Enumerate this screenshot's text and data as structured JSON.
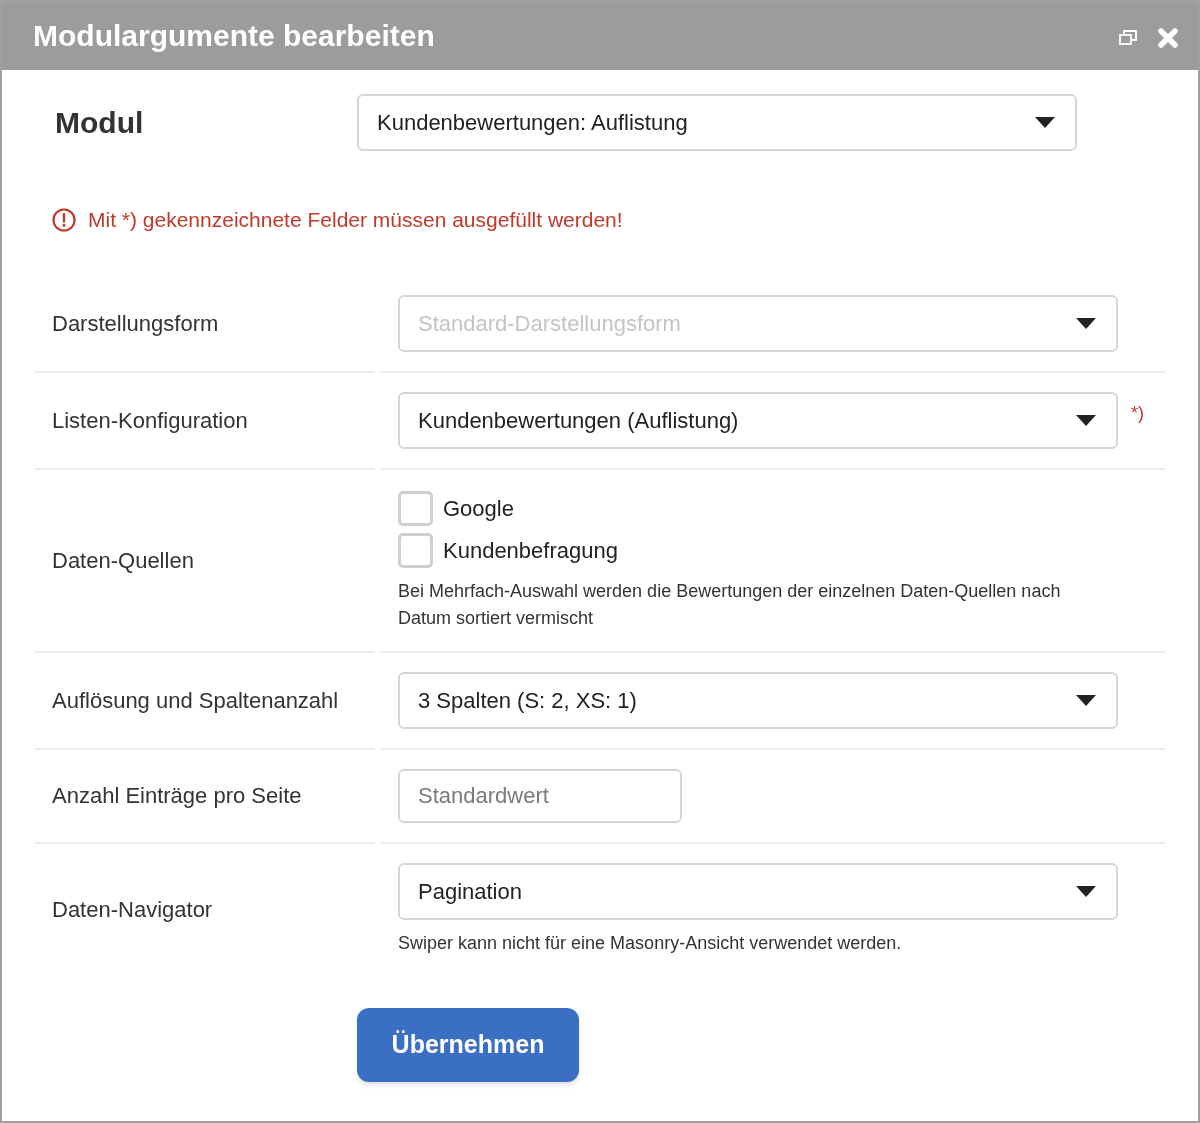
{
  "window": {
    "title": "Modulargumente bearbeiten"
  },
  "module": {
    "label": "Modul",
    "value": "Kundenbewertungen: Auflistung"
  },
  "notice": {
    "text": "Mit *) gekennzeichnete Felder müssen ausgefüllt werden!"
  },
  "rows": [
    {
      "kind": "select",
      "label": "Darstellungsform",
      "placeholder": "Standard-Darstellungsform"
    },
    {
      "kind": "select",
      "label": "Listen-Konfiguration",
      "value": "Kundenbewertungen (Auflistung)",
      "required_mark": "*)"
    },
    {
      "kind": "checkboxes",
      "label": "Daten-Quellen",
      "options": [
        {
          "label": "Google",
          "checked": false
        },
        {
          "label": "Kundenbefragung",
          "checked": false
        }
      ],
      "hint": "Bei Mehrfach-Auswahl werden die Bewertungen der einzelnen Daten-Quellen nach Datum sortiert vermischt"
    },
    {
      "kind": "select",
      "label": "Auflösung und Spaltenanzahl",
      "value": "3 Spalten (S: 2, XS: 1)"
    },
    {
      "kind": "input",
      "label": "Anzahl Einträge pro Seite",
      "placeholder": "Standardwert"
    },
    {
      "kind": "select",
      "label": "Daten-Navigator",
      "value": "Pagination",
      "hint": "Swiper kann nicht für eine Masonry-Ansicht verwendet werden."
    }
  ],
  "buttons": [
    {
      "label": "Übernehmen"
    }
  ]
}
